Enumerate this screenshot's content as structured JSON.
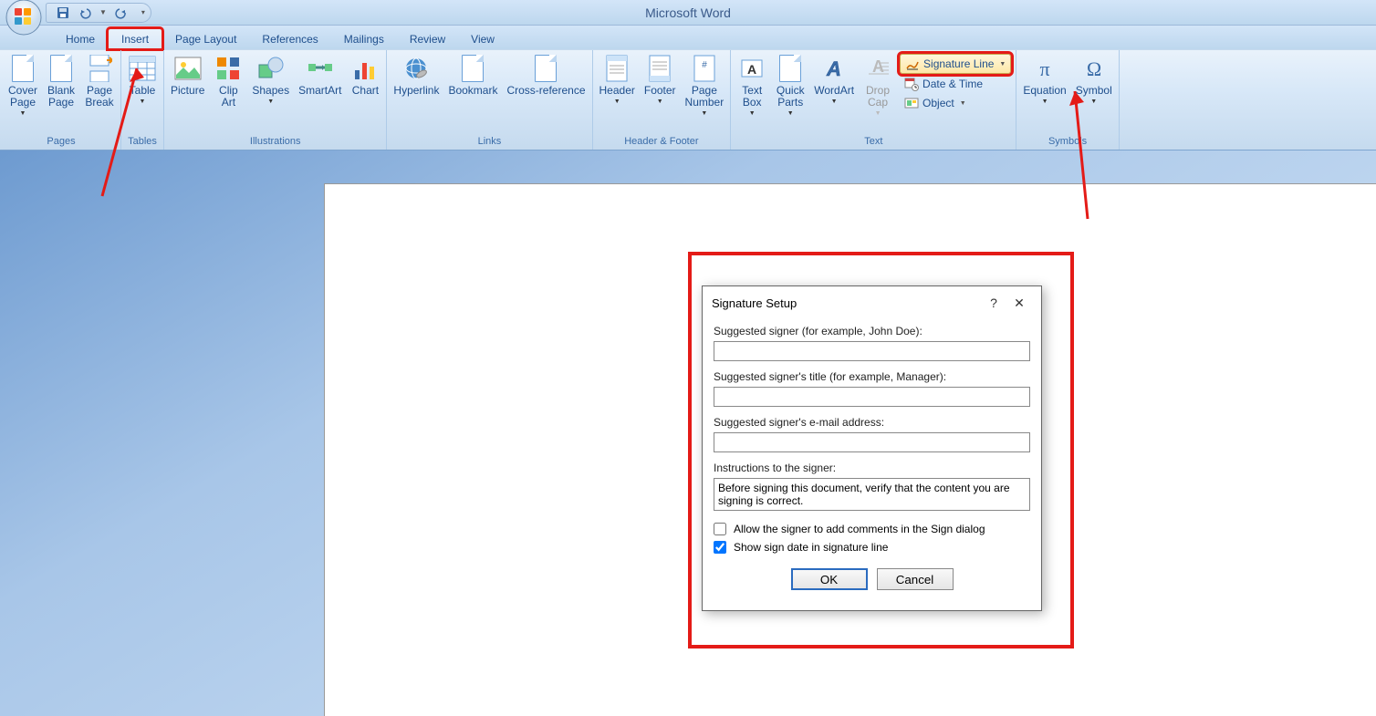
{
  "app_title": "Microsoft Word",
  "qat": {
    "save": "Save",
    "undo": "Undo",
    "redo": "Redo"
  },
  "tabs": [
    "Home",
    "Insert",
    "Page Layout",
    "References",
    "Mailings",
    "Review",
    "View"
  ],
  "active_tab": "Insert",
  "ribbon": {
    "groups": [
      {
        "label": "Pages",
        "items": [
          {
            "label": "Cover\nPage",
            "dd": true
          },
          {
            "label": "Blank\nPage"
          },
          {
            "label": "Page\nBreak"
          }
        ]
      },
      {
        "label": "Tables",
        "items": [
          {
            "label": "Table",
            "dd": true
          }
        ]
      },
      {
        "label": "Illustrations",
        "items": [
          {
            "label": "Picture"
          },
          {
            "label": "Clip\nArt"
          },
          {
            "label": "Shapes",
            "dd": true
          },
          {
            "label": "SmartArt"
          },
          {
            "label": "Chart"
          }
        ]
      },
      {
        "label": "Links",
        "items": [
          {
            "label": "Hyperlink"
          },
          {
            "label": "Bookmark"
          },
          {
            "label": "Cross-reference"
          }
        ]
      },
      {
        "label": "Header & Footer",
        "items": [
          {
            "label": "Header",
            "dd": true
          },
          {
            "label": "Footer",
            "dd": true
          },
          {
            "label": "Page\nNumber",
            "dd": true
          }
        ]
      },
      {
        "label": "Text",
        "items": [
          {
            "label": "Text\nBox",
            "dd": true
          },
          {
            "label": "Quick\nParts",
            "dd": true
          },
          {
            "label": "WordArt",
            "dd": true
          },
          {
            "label": "Drop\nCap",
            "dd": true,
            "disabled": true
          }
        ],
        "small": [
          {
            "label": "Signature Line",
            "dd": true,
            "highlight": true
          },
          {
            "label": "Date & Time"
          },
          {
            "label": "Object",
            "dd": true
          }
        ]
      },
      {
        "label": "Symbols",
        "items": [
          {
            "label": "Equation",
            "dd": true
          },
          {
            "label": "Symbol",
            "dd": true
          }
        ]
      }
    ]
  },
  "dialog": {
    "title": "Signature Setup",
    "signer_label": "Suggested signer (for example, John Doe):",
    "signer_value": "",
    "title_label": "Suggested signer's title (for example, Manager):",
    "title_value": "",
    "email_label": "Suggested signer's e-mail address:",
    "email_value": "",
    "instructions_label": "Instructions to the signer:",
    "instructions_value": "Before signing this document, verify that the content you are signing is correct.",
    "chk_comments": "Allow the signer to add comments in the Sign dialog",
    "chk_comments_checked": false,
    "chk_date": "Show sign date in signature line",
    "chk_date_checked": true,
    "ok": "OK",
    "cancel": "Cancel"
  }
}
